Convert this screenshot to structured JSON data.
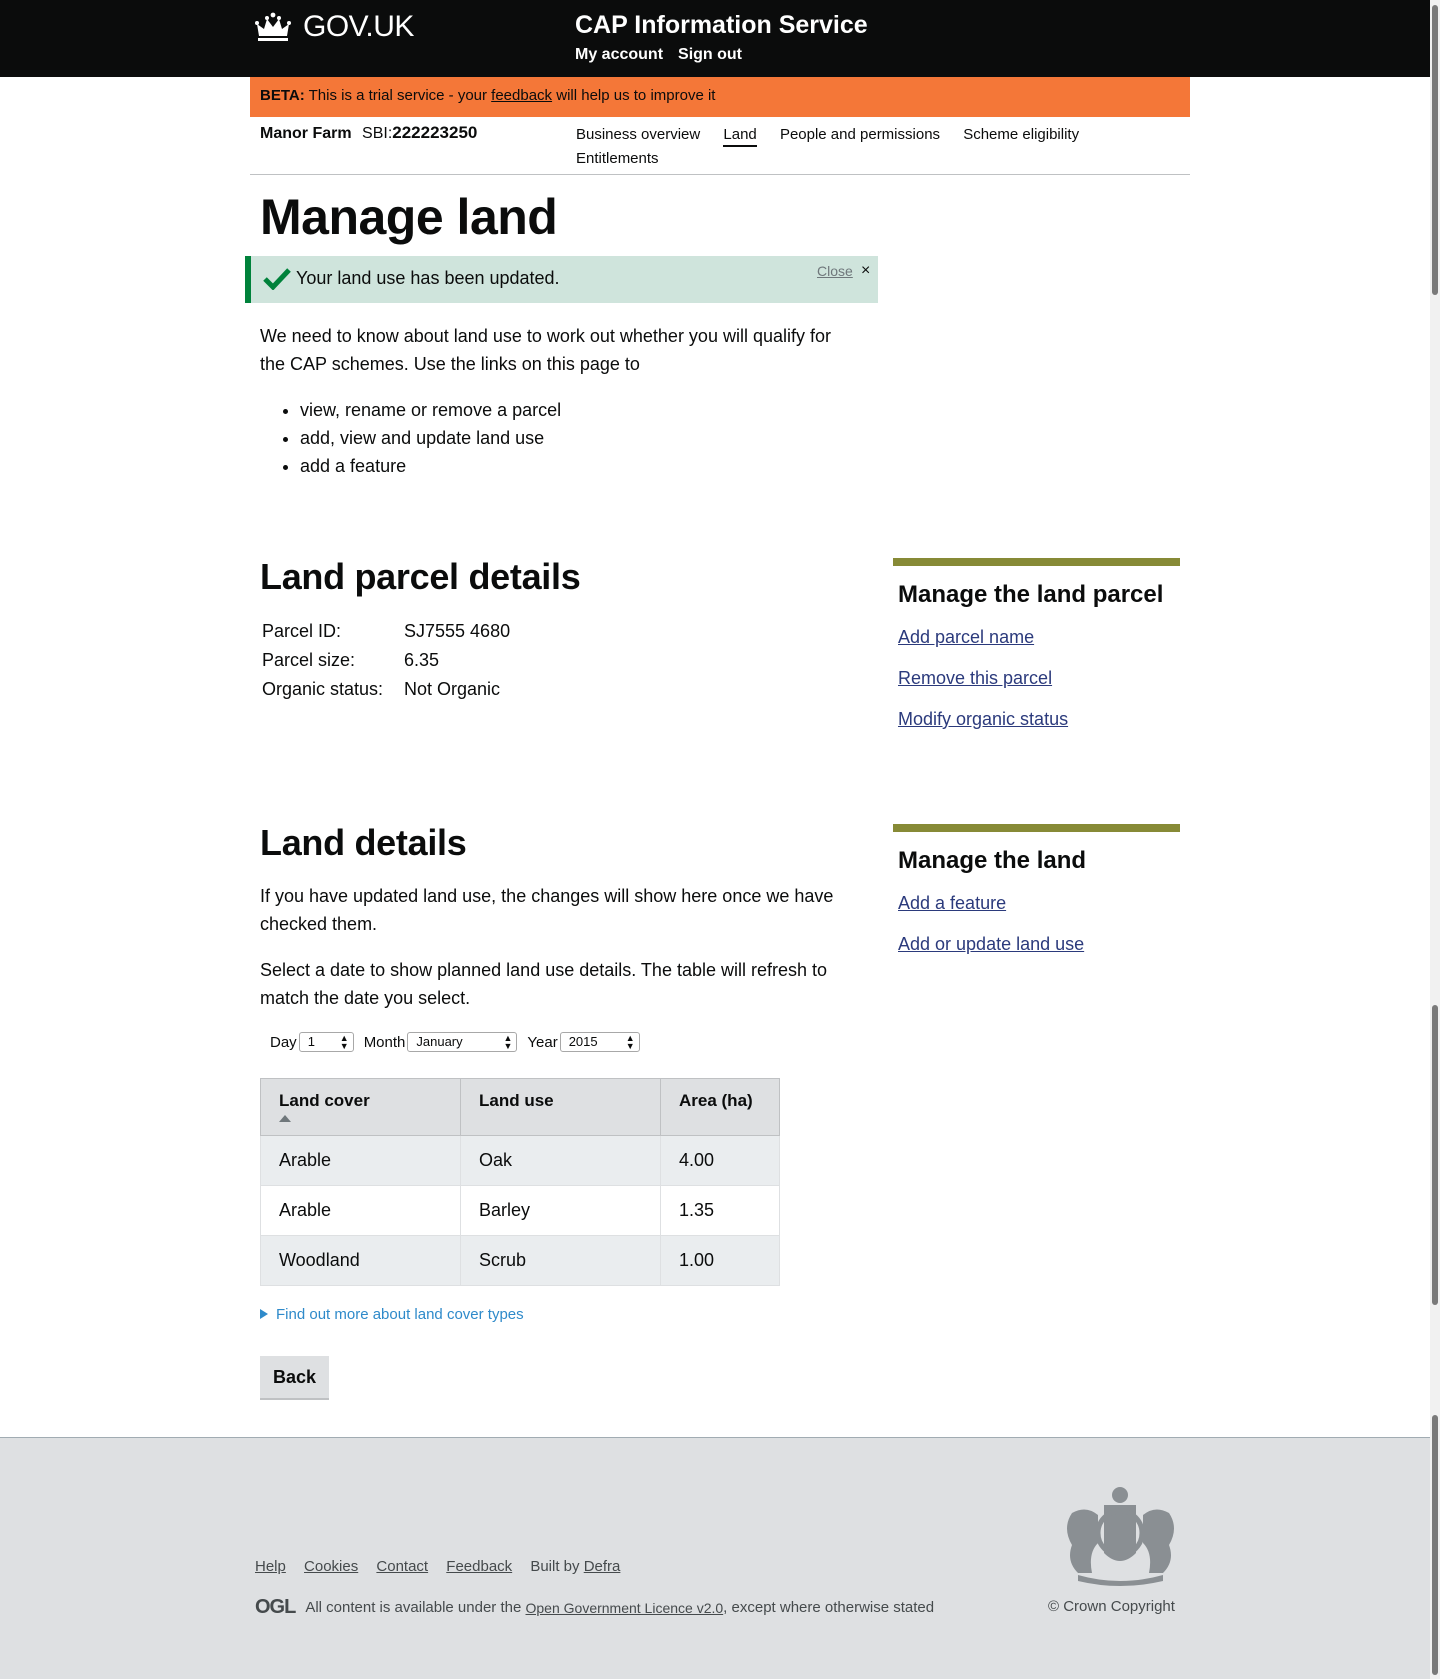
{
  "header": {
    "logo_text": "GOV.UK",
    "service_name": "CAP Information Service",
    "links": [
      "My account",
      "Sign out"
    ]
  },
  "beta": {
    "tag": "BETA:",
    "text_before": "This is a trial service - your",
    "link": "feedback",
    "text_after": "will help us to improve it"
  },
  "business": {
    "farm_name": "Manor Farm",
    "sbi_label": "SBI:",
    "sbi_number": "222223250",
    "nav": [
      "Business overview",
      "Land",
      "People and permissions",
      "Scheme eligibility",
      "Entitlements"
    ],
    "active_nav": "Land"
  },
  "page": {
    "title": "Manage land",
    "notice": {
      "message": "Your land use has been updated.",
      "close_label": "Close",
      "close_icon": "×"
    },
    "intro": "We need to know about land use to work out whether you will qualify for the CAP schemes. Use the links on this page to",
    "intro_list": [
      "view, rename or remove a parcel",
      "add, view and update land use",
      "add a feature"
    ]
  },
  "parcel": {
    "heading": "Land parcel details",
    "rows": [
      {
        "label": "Parcel ID:",
        "value": "SJ7555 4680"
      },
      {
        "label": "Parcel size:",
        "value": "6.35"
      },
      {
        "label": "Organic status:",
        "value": "Not Organic"
      }
    ]
  },
  "manage_parcel": {
    "heading": "Manage the land parcel",
    "links": [
      "Add parcel name",
      "Remove this parcel",
      "Modify organic status"
    ]
  },
  "land": {
    "heading": "Land details",
    "para1": "If you have updated land use, the changes will show here once we have checked them.",
    "para2": "Select a date to show planned land use details. The table will refresh to match the date you select.",
    "date": {
      "day_label": "Day",
      "day_value": "1",
      "month_label": "Month",
      "month_value": "January",
      "year_label": "Year",
      "year_value": "2015"
    },
    "table": {
      "headers": [
        "Land cover",
        "Land use",
        "Area (ha)"
      ],
      "rows": [
        [
          "Arable",
          "Oak",
          "4.00"
        ],
        [
          "Arable",
          "Barley",
          "1.35"
        ],
        [
          "Woodland",
          "Scrub",
          "1.00"
        ]
      ]
    },
    "details_summary": "Find out more about land cover types",
    "back_label": "Back"
  },
  "manage_land": {
    "heading": "Manage the land",
    "links": [
      "Add a feature",
      "Add or update land use"
    ]
  },
  "footer": {
    "links": [
      "Help",
      "Cookies",
      "Contact",
      "Feedback"
    ],
    "built_by": "Built by",
    "built_by_link": "Defra",
    "ogl_logo": "OGL",
    "licence_before": "All content is available under the",
    "licence_link": "Open Government Licence v2.0",
    "licence_after": ", except where otherwise stated",
    "copyright": "© Crown Copyright"
  },
  "colors": {
    "header_bg": "#0b0c0c",
    "beta_bg": "#f47738",
    "notice_bg": "#cfe4dc",
    "notice_border": "#00823b",
    "sidebox_border": "#878a36",
    "link": "#2b3a7c",
    "footer_bg": "#dee0e2"
  }
}
